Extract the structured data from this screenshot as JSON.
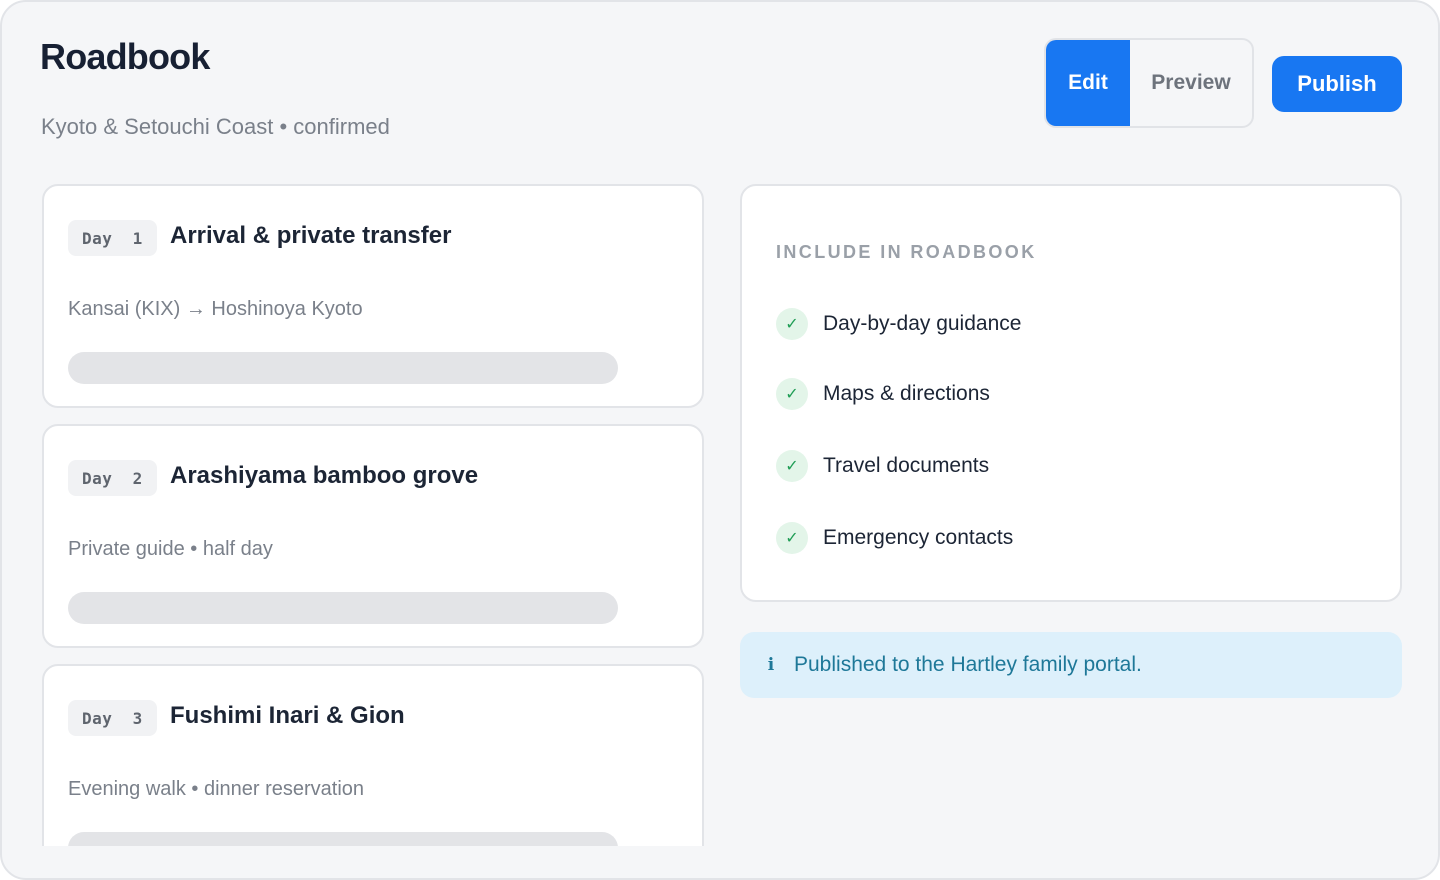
{
  "header": {
    "title": "Roadbook",
    "subtitle": "Kyoto & Setouchi Coast • confirmed"
  },
  "mode_toggle": {
    "edit_label": "Edit",
    "preview_label": "Preview",
    "active": "Edit"
  },
  "actions": {
    "publish_label": "Publish"
  },
  "days": [
    {
      "badge": "Day  1",
      "title": "Arrival & private transfer",
      "description": "Kansai (KIX) → Hoshinoya Kyoto"
    },
    {
      "badge": "Day  2",
      "title": "Arashiyama bamboo grove",
      "description": "Private guide • half day"
    },
    {
      "badge": "Day  3",
      "title": "Fushimi Inari & Gion",
      "description": "Evening walk • dinner reservation"
    }
  ],
  "include": {
    "heading": "INCLUDE IN ROADBOOK",
    "options": [
      {
        "label": "Day-by-day guidance",
        "checked": true
      },
      {
        "label": "Maps & directions",
        "checked": true
      },
      {
        "label": "Travel documents",
        "checked": true
      },
      {
        "label": "Emergency contacts",
        "checked": true
      }
    ]
  },
  "notice": {
    "icon": "info-icon",
    "text": "Published to the Hartley family portal."
  },
  "colors": {
    "accent": "#1877f2",
    "success": "#1f9d55",
    "info_bg": "#ddf0fb",
    "info_text": "#1e7898"
  }
}
